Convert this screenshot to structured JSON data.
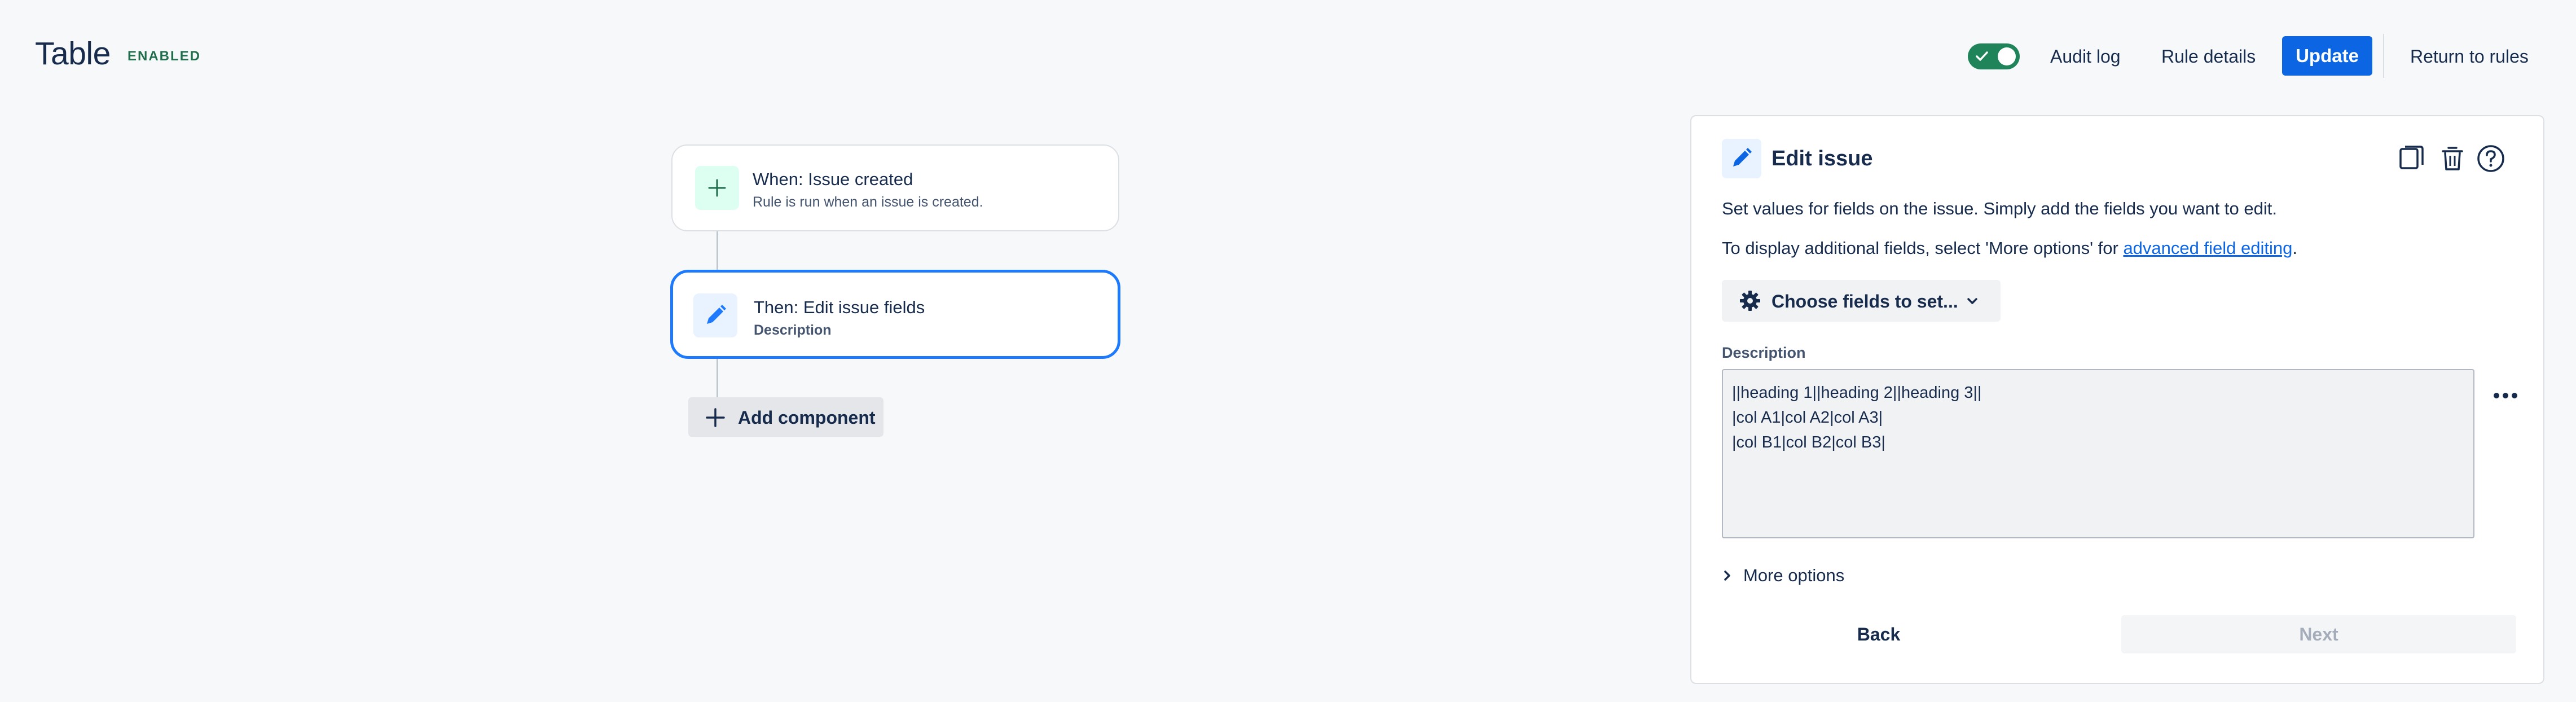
{
  "header": {
    "title": "Table",
    "status_badge": "ENABLED",
    "toggle_on": true,
    "audit_log": "Audit log",
    "rule_details": "Rule details",
    "update": "Update",
    "return_to_rules": "Return to rules"
  },
  "flow": {
    "trigger": {
      "title": "When: Issue created",
      "subtitle": "Rule is run when an issue is created.",
      "icon": "plus-icon"
    },
    "action": {
      "title": "Then: Edit issue fields",
      "subtitle": "Description",
      "icon": "pencil-icon"
    },
    "add_component": "Add component"
  },
  "panel": {
    "title": "Edit issue",
    "icon": "pencil-icon",
    "tools": [
      "copy-icon",
      "trash-icon",
      "help-icon"
    ],
    "intro": "Set values for fields on the issue. Simply add the fields you want to edit.",
    "more_info_prefix": "To display additional fields, select 'More options' for ",
    "more_info_link": "advanced field editing",
    "more_info_suffix": ".",
    "choose_fields": "Choose fields to set...",
    "description_label": "Description",
    "description_value": "||heading 1||heading 2||heading 3||\n|col A1|col A2|col A3|\n|col B1|col B2|col B3|",
    "more_options": "More options",
    "back": "Back",
    "next": "Next"
  },
  "colors": {
    "brand_blue": "#0c66e4",
    "success_green": "#1f845a",
    "selected_border": "#1d7afc"
  }
}
